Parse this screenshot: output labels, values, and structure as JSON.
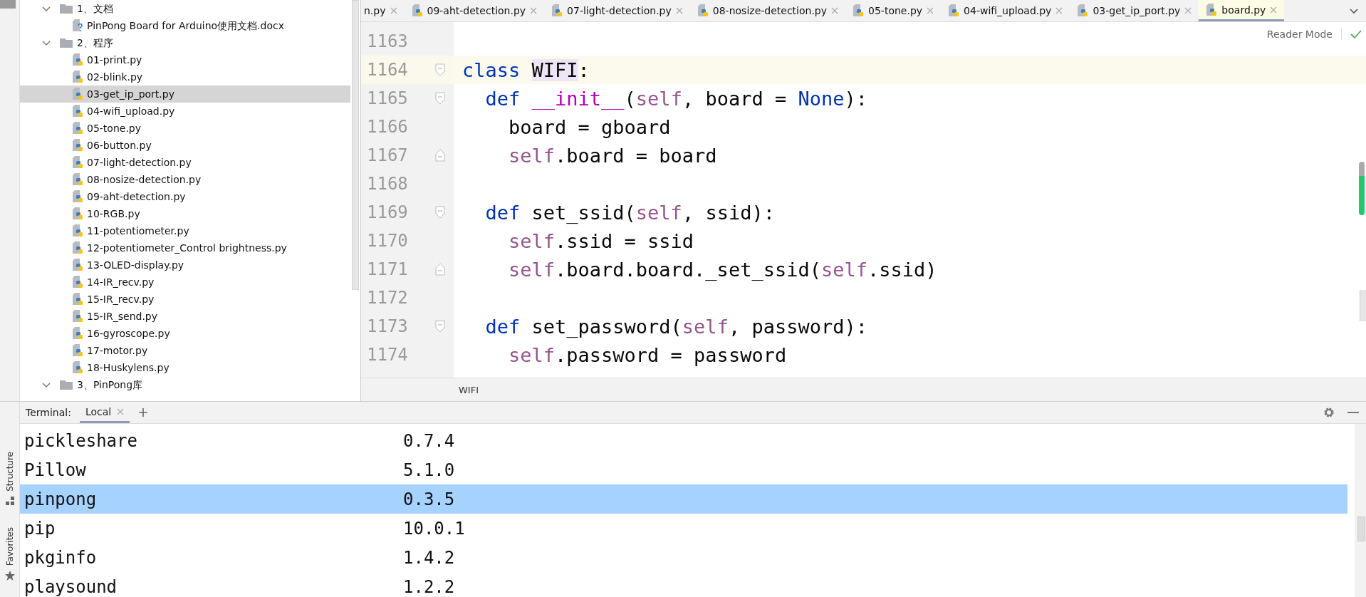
{
  "project_tree": {
    "items": [
      {
        "label": "1、文档",
        "kind": "folder",
        "expanded": true,
        "selected": false,
        "children": [
          {
            "label": "PinPong Board for Arduino使用文档.docx",
            "kind": "doc",
            "selected": false
          }
        ]
      },
      {
        "label": "2、程序",
        "kind": "folder",
        "expanded": true,
        "selected": false,
        "children": [
          {
            "label": "01-print.py",
            "kind": "python",
            "selected": false
          },
          {
            "label": "02-blink.py",
            "kind": "python",
            "selected": false
          },
          {
            "label": "03-get_ip_port.py",
            "kind": "python",
            "selected": true
          },
          {
            "label": "04-wifi_upload.py",
            "kind": "python",
            "selected": false
          },
          {
            "label": "05-tone.py",
            "kind": "python",
            "selected": false
          },
          {
            "label": "06-button.py",
            "kind": "python",
            "selected": false
          },
          {
            "label": "07-light-detection.py",
            "kind": "python",
            "selected": false
          },
          {
            "label": "08-nosize-detection.py",
            "kind": "python",
            "selected": false
          },
          {
            "label": "09-aht-detection.py",
            "kind": "python",
            "selected": false
          },
          {
            "label": "10-RGB.py",
            "kind": "python",
            "selected": false
          },
          {
            "label": "11-potentiometer.py",
            "kind": "python",
            "selected": false
          },
          {
            "label": "12-potentiometer_Control brightness.py",
            "kind": "python",
            "selected": false
          },
          {
            "label": "13-OLED-display.py",
            "kind": "python",
            "selected": false
          },
          {
            "label": "14-IR_recv.py",
            "kind": "python",
            "selected": false
          },
          {
            "label": "15-IR_recv.py",
            "kind": "python",
            "selected": false
          },
          {
            "label": "15-IR_send.py",
            "kind": "python",
            "selected": false
          },
          {
            "label": "16-gyroscope.py",
            "kind": "python",
            "selected": false
          },
          {
            "label": "17-motor.py",
            "kind": "python",
            "selected": false
          },
          {
            "label": "18-Huskylens.py",
            "kind": "python",
            "selected": false
          }
        ]
      },
      {
        "label": "3、PinPong库",
        "kind": "folder",
        "expanded": true,
        "selected": false
      }
    ]
  },
  "editor_tabs": [
    {
      "label": "n.py",
      "selected": false
    },
    {
      "label": "09-aht-detection.py",
      "selected": false
    },
    {
      "label": "07-light-detection.py",
      "selected": false
    },
    {
      "label": "08-nosize-detection.py",
      "selected": false
    },
    {
      "label": "05-tone.py",
      "selected": false
    },
    {
      "label": "04-wifi_upload.py",
      "selected": false
    },
    {
      "label": "03-get_ip_port.py",
      "selected": false
    },
    {
      "label": "board.py",
      "selected": true
    }
  ],
  "reader_mode": "Reader Mode",
  "code_lines": [
    {
      "number": "1163",
      "current": false,
      "kind": "plain"
    },
    {
      "number": "1164",
      "current": true,
      "kind": "fold_start",
      "tokens": [
        {
          "kind": "keyword",
          "text": "class "
        },
        {
          "kind": "caret_word",
          "text": "WIFI"
        },
        {
          "kind": "plain",
          "text": ":"
        }
      ]
    },
    {
      "number": "1165",
      "current": false,
      "kind": "fold_start",
      "tokens": [
        {
          "kind": "keyword",
          "text": "  def "
        },
        {
          "kind": "magic",
          "text": "__init__"
        },
        {
          "kind": "plain",
          "text": "("
        },
        {
          "kind": "self",
          "text": "self"
        },
        {
          "kind": "plain",
          "text": ", board = "
        },
        {
          "kind": "keyword",
          "text": "None"
        },
        {
          "kind": "plain",
          "text": "):"
        }
      ]
    },
    {
      "number": "1166",
      "current": false,
      "kind": "plain",
      "tokens": [
        {
          "kind": "plain",
          "text": "    board = gboard"
        }
      ]
    },
    {
      "number": "1167",
      "current": false,
      "kind": "fold_end",
      "tokens": [
        {
          "kind": "self",
          "text": "    self"
        },
        {
          "kind": "plain",
          "text": ".board = board"
        }
      ]
    },
    {
      "number": "1168",
      "current": false,
      "kind": "plain"
    },
    {
      "number": "1169",
      "current": false,
      "kind": "fold_start",
      "tokens": [
        {
          "kind": "keyword",
          "text": "  def"
        },
        {
          "kind": "plain",
          "text": " set_ssid("
        },
        {
          "kind": "self",
          "text": "self"
        },
        {
          "kind": "plain",
          "text": ", ssid):"
        }
      ]
    },
    {
      "number": "1170",
      "current": false,
      "kind": "plain",
      "tokens": [
        {
          "kind": "self",
          "text": "    self"
        },
        {
          "kind": "plain",
          "text": ".ssid = ssid"
        }
      ]
    },
    {
      "number": "1171",
      "current": false,
      "kind": "fold_end",
      "tokens": [
        {
          "kind": "self",
          "text": "    self"
        },
        {
          "kind": "plain",
          "text": ".board.board._set_ssid("
        },
        {
          "kind": "self",
          "text": "self"
        },
        {
          "kind": "plain",
          "text": ".ssid)"
        }
      ]
    },
    {
      "number": "1172",
      "current": false,
      "kind": "plain"
    },
    {
      "number": "1173",
      "current": false,
      "kind": "fold_start",
      "tokens": [
        {
          "kind": "keyword",
          "text": "  def"
        },
        {
          "kind": "plain",
          "text": " set_password("
        },
        {
          "kind": "self",
          "text": "self"
        },
        {
          "kind": "plain",
          "text": ", password):"
        }
      ]
    },
    {
      "number": "1174",
      "current": false,
      "kind": "plain",
      "tokens": [
        {
          "kind": "self",
          "text": "    self"
        },
        {
          "kind": "plain",
          "text": ".password = password"
        }
      ]
    }
  ],
  "breadcrumb": "WIFI",
  "terminal": {
    "label": "Terminal:",
    "tabs": [
      {
        "label": "Local",
        "selected": true
      }
    ],
    "rows": [
      {
        "name": "pickleshare",
        "version": "0.7.4",
        "selected": false
      },
      {
        "name": "Pillow",
        "version": "5.1.0",
        "selected": false
      },
      {
        "name": "pinpong",
        "version": "0.3.5",
        "selected": true
      },
      {
        "name": "pip",
        "version": "10.0.1",
        "selected": false
      },
      {
        "name": "pkginfo",
        "version": "1.4.2",
        "selected": false
      },
      {
        "name": "playsound",
        "version": "1.2.2",
        "selected": false
      }
    ]
  },
  "side_tools": [
    {
      "label": "Structure",
      "kind": "structure"
    },
    {
      "label": "Favorites",
      "kind": "favorites"
    }
  ]
}
